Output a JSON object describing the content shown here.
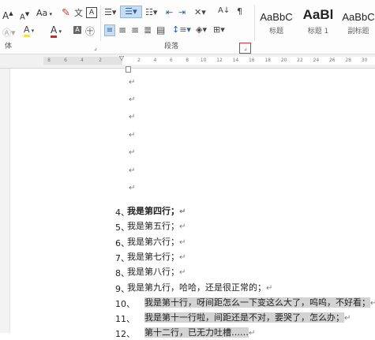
{
  "ribbon": {
    "font_group": {
      "grow_font": "A",
      "shrink_font": "A",
      "change_case": "Aa",
      "highlight_letter": "A",
      "font_color_letter": "A",
      "label_partial": "体"
    },
    "paragraph_group": {
      "label": "段落"
    },
    "styles_group": {
      "items": [
        {
          "sample": "AaBbC",
          "name": "标题"
        },
        {
          "sample": "AaBl",
          "name": "标题 1"
        },
        {
          "sample": "AaBbC",
          "name": "副标题"
        }
      ]
    }
  },
  "ruler": {
    "left_ticks": [
      "8",
      "6",
      "4",
      "2"
    ],
    "right_ticks": [
      "2",
      "4",
      "6",
      "8",
      "10",
      "12",
      "14",
      "16",
      "18",
      "20",
      "22",
      "24",
      "26",
      "28",
      "30",
      "32"
    ]
  },
  "document": {
    "paragraph_mark": "↵",
    "lines": [
      {
        "num": "4、",
        "text": "我是第四行；",
        "bold": true,
        "highlight": false
      },
      {
        "num": "5、",
        "text": "我是第五行；",
        "bold": false,
        "highlight": false
      },
      {
        "num": "6、",
        "text": "我是第六行；",
        "bold": false,
        "highlight": false
      },
      {
        "num": "7、",
        "text": "我是第七行；",
        "bold": false,
        "highlight": false
      },
      {
        "num": "8、",
        "text": "我是第八行；",
        "bold": false,
        "highlight": false
      },
      {
        "num": "9、",
        "text": "我是第九行，哈哈，还是很正常的；",
        "bold": false,
        "highlight": false
      },
      {
        "num": "10、",
        "text": "我是第十行，呀间距怎么一下变这么大了，呜呜，不好看；",
        "bold": false,
        "highlight": true
      },
      {
        "num": "11、",
        "text": "我是第十一行啦，间距还是不对，要哭了，怎么办；",
        "bold": false,
        "highlight": true
      },
      {
        "num": "12、",
        "text": "第十二行，已无力吐槽……",
        "bold": false,
        "highlight": true
      }
    ]
  },
  "colors": {
    "highlight_yellow": "#f4e04a",
    "font_red": "#d9261c",
    "active_button": "#c5def5",
    "dialog_launcher_box": "#e03030",
    "selection_gray": "#d3d3d3"
  }
}
